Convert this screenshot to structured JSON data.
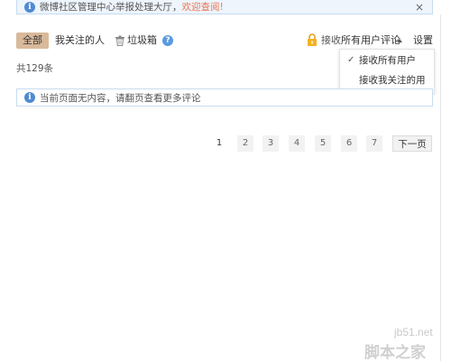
{
  "notice": {
    "text": "微博社区管理中心举报处理大厅，",
    "link": "欢迎查阅",
    "link_mark": "!",
    "close": "×"
  },
  "filters": {
    "all": "全部",
    "following": "我关注的人",
    "trash": "垃圾箱",
    "help": "?",
    "receive_label": "接收",
    "receive_value": "所有用户评论",
    "settings": "设置"
  },
  "count": "共129条",
  "dropdown": {
    "options": [
      "接收所有用户",
      "接收我关注的用户"
    ],
    "check": "✓"
  },
  "empty_message": "当前页面无内容，请翻页查看更多评论",
  "pagination": {
    "pages": [
      "1",
      "2",
      "3",
      "4",
      "5",
      "6",
      "7"
    ],
    "current": "1",
    "next": "下一页"
  },
  "watermark": {
    "url": "jb51.net",
    "brand": "脚本之家"
  },
  "icons": [
    "info-icon",
    "close-icon",
    "trash-icon",
    "help-icon",
    "lock-icon",
    "caret-up-icon",
    "check-icon"
  ],
  "colors": {
    "accent_link": "#eb7350",
    "active_tab": "#d9b99b",
    "info_blue": "#4f8ad1",
    "notice_bg": "#eef5fd"
  }
}
